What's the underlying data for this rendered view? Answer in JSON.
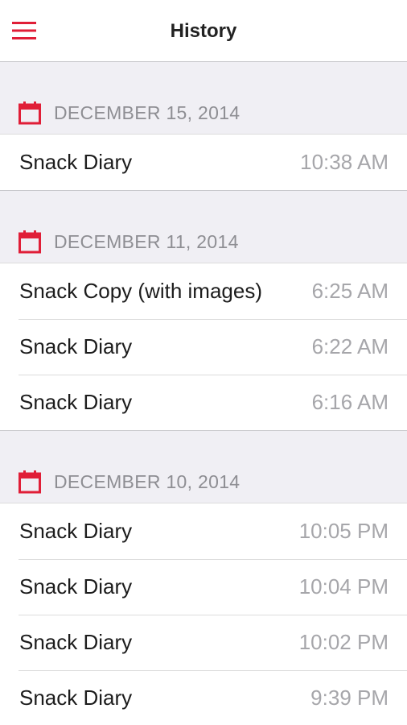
{
  "header": {
    "title": "History",
    "menu_icon": "hamburger-menu-icon"
  },
  "colors": {
    "accent": "#e01e37",
    "header_bg": "#ffffff",
    "section_bg": "#f0eff4",
    "time_text": "#a6a6aa",
    "date_text": "#8e8e93"
  },
  "sections": [
    {
      "date": "DECEMBER 15, 2014",
      "icon": "calendar-icon",
      "entries": [
        {
          "title": "Snack Diary",
          "time": "10:38 AM"
        }
      ]
    },
    {
      "date": "DECEMBER 11, 2014",
      "icon": "calendar-icon",
      "entries": [
        {
          "title": "Snack Copy (with images)",
          "time": "6:25 AM"
        },
        {
          "title": "Snack Diary",
          "time": "6:22 AM"
        },
        {
          "title": "Snack Diary",
          "time": "6:16 AM"
        }
      ]
    },
    {
      "date": "DECEMBER 10, 2014",
      "icon": "calendar-icon",
      "entries": [
        {
          "title": "Snack Diary",
          "time": "10:05 PM"
        },
        {
          "title": "Snack Diary",
          "time": "10:04 PM"
        },
        {
          "title": "Snack Diary",
          "time": "10:02 PM"
        },
        {
          "title": "Snack Diary",
          "time": "9:39 PM"
        }
      ]
    }
  ]
}
